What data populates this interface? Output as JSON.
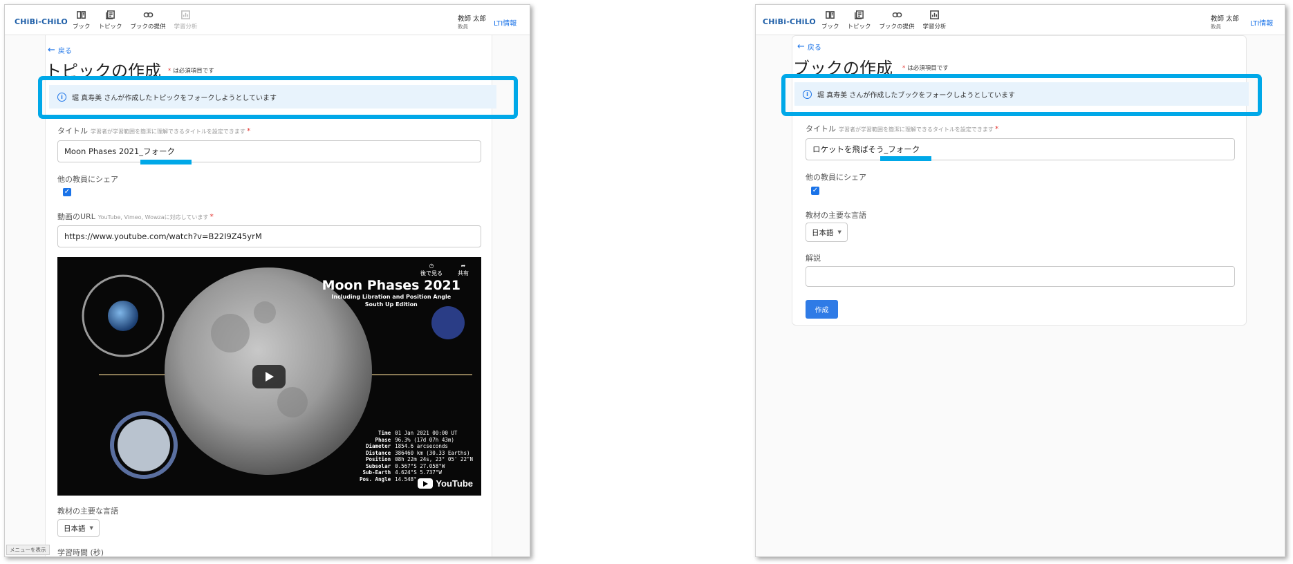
{
  "left": {
    "app": {
      "logo": "CHiBi-CHiLO",
      "nav": [
        {
          "label": "ブック",
          "icon": "book-icon"
        },
        {
          "label": "トピック",
          "icon": "topic-icon"
        },
        {
          "label": "ブックの提供",
          "icon": "link-icon"
        },
        {
          "label": "学習分析",
          "icon": "analytics-icon",
          "disabled": true
        }
      ],
      "user_name": "教師 太郎",
      "user_role": "教員",
      "lti_link": "LTI情報"
    },
    "back_label": "戻る",
    "page_title": "トピックの作成",
    "required_note": "は必須項目です",
    "alert_message": "堀 真寿美 さんが作成したトピックをフォークしようとしています",
    "title_field": {
      "label": "タイトル",
      "hint": "学習者が学習範囲を簡潔に理解できるタイトルを設定できます",
      "value": "Moon Phases 2021_フォーク"
    },
    "share_label": "他の教員にシェア",
    "share_checked": true,
    "video_url_field": {
      "label": "動画のURL",
      "hint": "YouTube, Vimeo, Wowzaに対応しています",
      "value": "https://www.youtube.com/watch?v=B22I9Z45yrM"
    },
    "video": {
      "title": "Moon Phases 2021",
      "subtitle1": "Including Libration and Position Angle",
      "subtitle2": "South Up Edition",
      "watch_later": "後で見る",
      "share": "共有",
      "stats": [
        {
          "k": "Time",
          "v": "01 Jan 2021 00:00 UT"
        },
        {
          "k": "Phase",
          "v": "96.3% (17d 07h 43m)"
        },
        {
          "k": "Diameter",
          "v": "1854.6 arcseconds"
        },
        {
          "k": "Distance",
          "v": "386460 km (30.33 Earths)"
        },
        {
          "k": "Position",
          "v": "08h 22m 24s, 23° 05' 22\"N"
        },
        {
          "k": "Subsolar",
          "v": "0.567°S 27.058°W"
        },
        {
          "k": "Sub-Earth",
          "v": "4.624°S 5.737°W"
        },
        {
          "k": "Pos. Angle",
          "v": "14.548°"
        }
      ],
      "brand": "YouTube"
    },
    "language_label": "教材の主要な言語",
    "language_value": "日本語",
    "study_time_label": "学習時間 (秒)",
    "menu_chip": "メニューを表示"
  },
  "right": {
    "app": {
      "logo": "CHiBi-CHiLO",
      "nav": [
        {
          "label": "ブック",
          "icon": "book-icon"
        },
        {
          "label": "トピック",
          "icon": "topic-icon"
        },
        {
          "label": "ブックの提供",
          "icon": "link-icon"
        },
        {
          "label": "学習分析",
          "icon": "analytics-icon"
        }
      ],
      "user_name": "教師 太郎",
      "user_role": "教員",
      "lti_link": "LTI情報"
    },
    "back_label": "戻る",
    "page_title": "ブックの作成",
    "required_note": "は必須項目です",
    "alert_message": "堀 真寿美 さんが作成したブックをフォークしようとしています",
    "title_field": {
      "label": "タイトル",
      "hint": "学習者が学習範囲を簡潔に理解できるタイトルを設定できます",
      "value": "ロケットを飛ばそう_フォーク"
    },
    "share_label": "他の教員にシェア",
    "share_checked": true,
    "language_label": "教材の主要な言語",
    "language_value": "日本語",
    "description_label": "解説",
    "description_value": "",
    "create_button": "作成"
  },
  "colors": {
    "highlight": "#00a8e8",
    "accent": "#1a73e8",
    "alert_bg": "#e8f3fc",
    "required": "#e53935"
  }
}
